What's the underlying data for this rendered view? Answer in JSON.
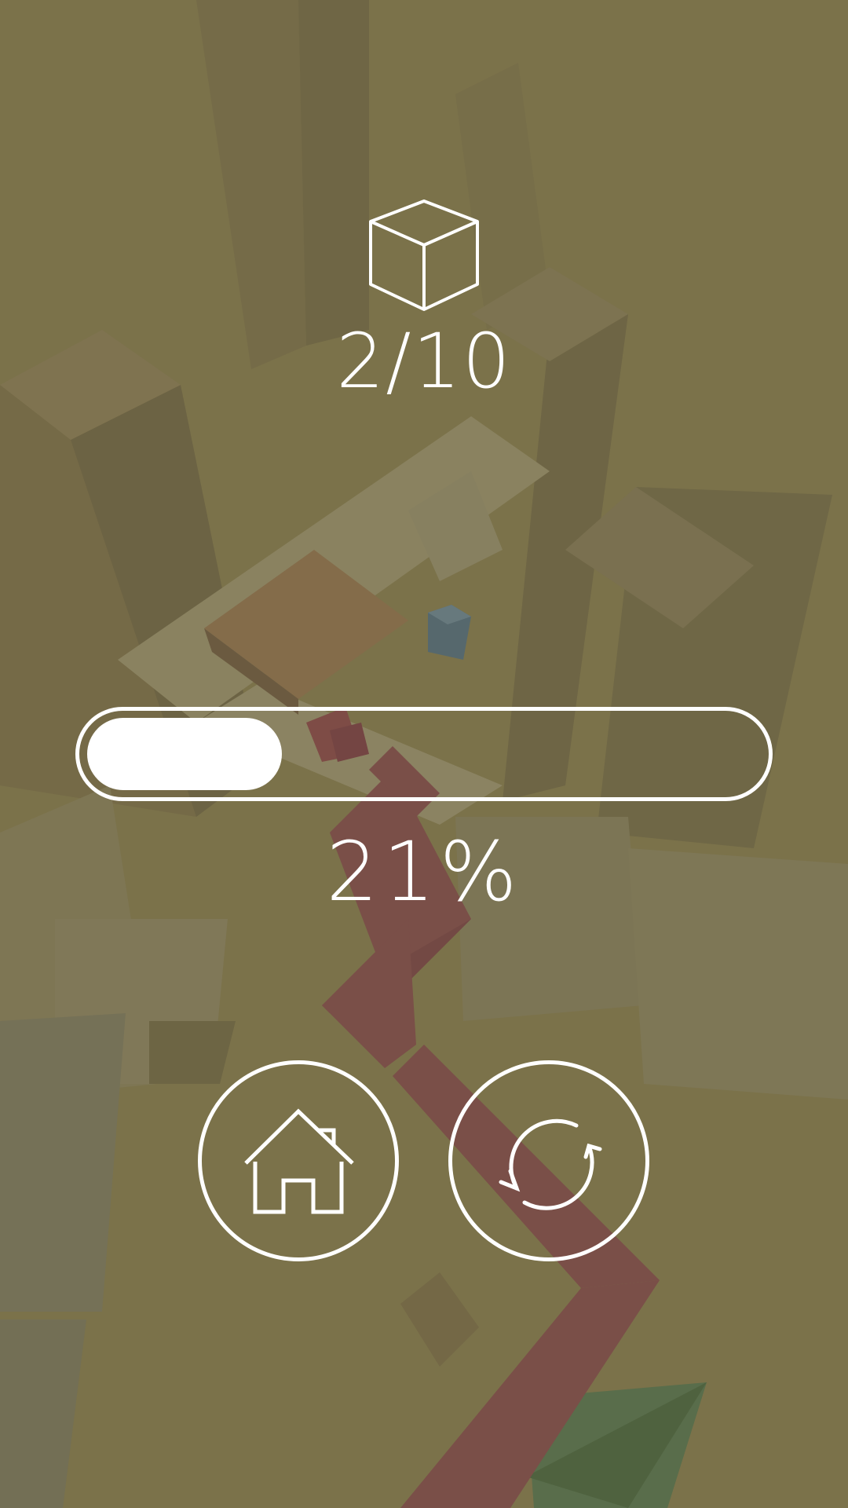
{
  "hud": {
    "cubes_collected": "2/10",
    "progress_text": "21%",
    "progress_fraction": 0.21
  },
  "buttons": {
    "home_icon": "home-icon",
    "restart_icon": "restart-icon"
  },
  "colors": {
    "ui": "#ffffff",
    "path": "#7a4f48",
    "collectible_cube": "#56686d",
    "background": "#7a714b"
  }
}
